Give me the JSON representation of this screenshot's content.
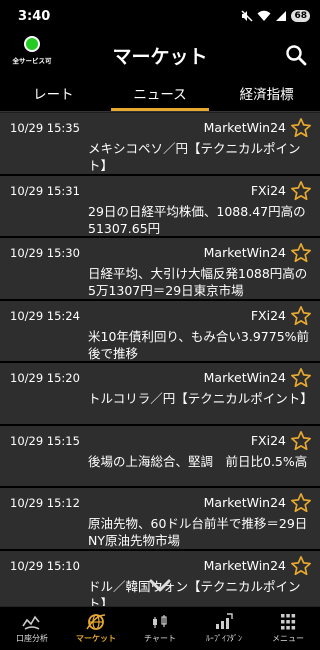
{
  "status": {
    "time": "3:40",
    "battery": "68"
  },
  "header": {
    "service_label": "全サービス可",
    "title": "マーケット"
  },
  "tabs": [
    {
      "label": "レート",
      "active": false
    },
    {
      "label": "ニュース",
      "active": true
    },
    {
      "label": "経済指標",
      "active": false
    }
  ],
  "news": [
    {
      "time": "10/29 15:35",
      "source": "MarketWin24",
      "headline": "メキシコペソ／円【テクニカルポイント】"
    },
    {
      "time": "10/29 15:31",
      "source": "FXi24",
      "headline": "29日の日経平均株価、1088.47円高の51307.65円"
    },
    {
      "time": "10/29 15:30",
      "source": "MarketWin24",
      "headline": "日経平均、大引け大幅反発1088円高の5万1307円＝29日東京市場"
    },
    {
      "time": "10/29 15:24",
      "source": "FXi24",
      "headline": "米10年債利回り、もみ合い3.9775%前後で推移"
    },
    {
      "time": "10/29 15:20",
      "source": "MarketWin24",
      "headline": "トルコリラ／円【テクニカルポイント】"
    },
    {
      "time": "10/29 15:15",
      "source": "FXi24",
      "headline": "後場の上海総合、堅調　前日比0.5%高"
    },
    {
      "time": "10/29 15:12",
      "source": "MarketWin24",
      "headline": "原油先物、60ドル台前半で推移＝29日NY原油先物市場"
    },
    {
      "time": "10/29 15:10",
      "source": "MarketWin24",
      "headline": "ドル／韓国ウォン【テクニカルポイント】"
    }
  ],
  "nav": [
    {
      "label": "口座分析",
      "icon": "account-analysis-icon",
      "active": false
    },
    {
      "label": "マーケット",
      "icon": "market-globe-icon",
      "active": true
    },
    {
      "label": "チャート",
      "icon": "chart-icon",
      "active": false
    },
    {
      "label": "ﾙｰﾌﾟｲﾌﾀﾞﾝ",
      "icon": "loop-ifdone-icon",
      "active": false
    },
    {
      "label": "メニュー",
      "icon": "menu-grid-icon",
      "active": false
    }
  ],
  "colors": {
    "accent": "#e8a92f",
    "item_bg": "#2e2e2e",
    "status_ok": "#22cc22"
  }
}
